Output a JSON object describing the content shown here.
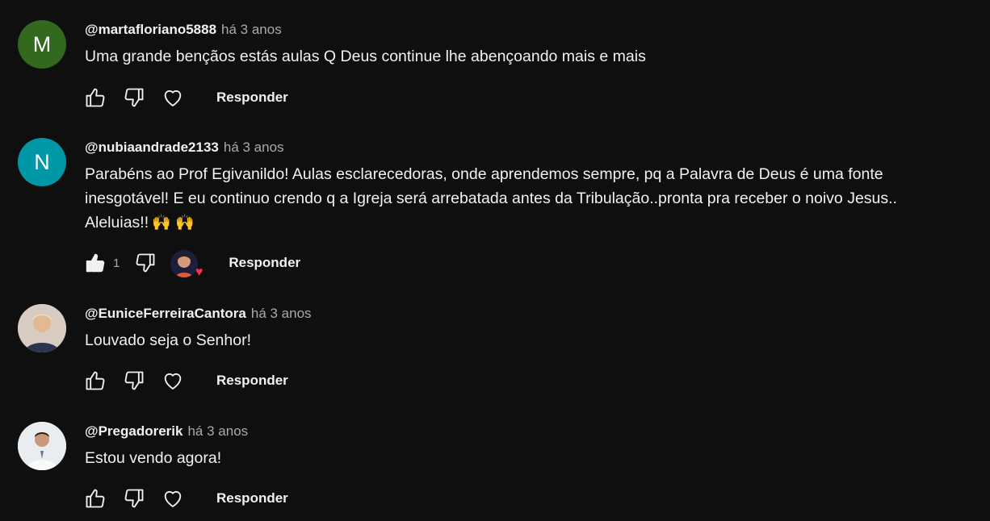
{
  "comments": [
    {
      "author": "@martafloriano5888",
      "time": "há 3 anos",
      "avatar_letter": "M",
      "avatar_color": "#33691e",
      "lines": [
        "Uma grande bençãos estás aulas Q Deus continue lhe abençoando mais e mais"
      ],
      "like_count": "",
      "reply_label": "Responder"
    },
    {
      "author": "@nubiaandrade2133",
      "time": "há 3 anos",
      "avatar_letter": "N",
      "avatar_color": "#0097a7",
      "lines": [
        "Parabéns ao Prof Egivanildo! Aulas esclarecedoras, onde aprendemos sempre, pq a Palavra de Deus é uma fonte",
        "inesgotável! E eu continuo crendo q a Igreja será arrebatada antes da Tribulação..pronta pra receber o noivo Jesus..",
        "Aleluias!!"
      ],
      "emojis": "🙌 🙌",
      "like_count": "1",
      "reply_label": "Responder"
    },
    {
      "author": "@EuniceFerreiraCantora",
      "time": "há 3 anos",
      "lines": [
        "Louvado seja o Senhor!"
      ],
      "like_count": "",
      "reply_label": "Responder"
    },
    {
      "author": "@Pregadorerik",
      "time": "há 3 anos",
      "lines": [
        "Estou vendo agora!"
      ],
      "like_count": "",
      "reply_label": "Responder"
    }
  ]
}
